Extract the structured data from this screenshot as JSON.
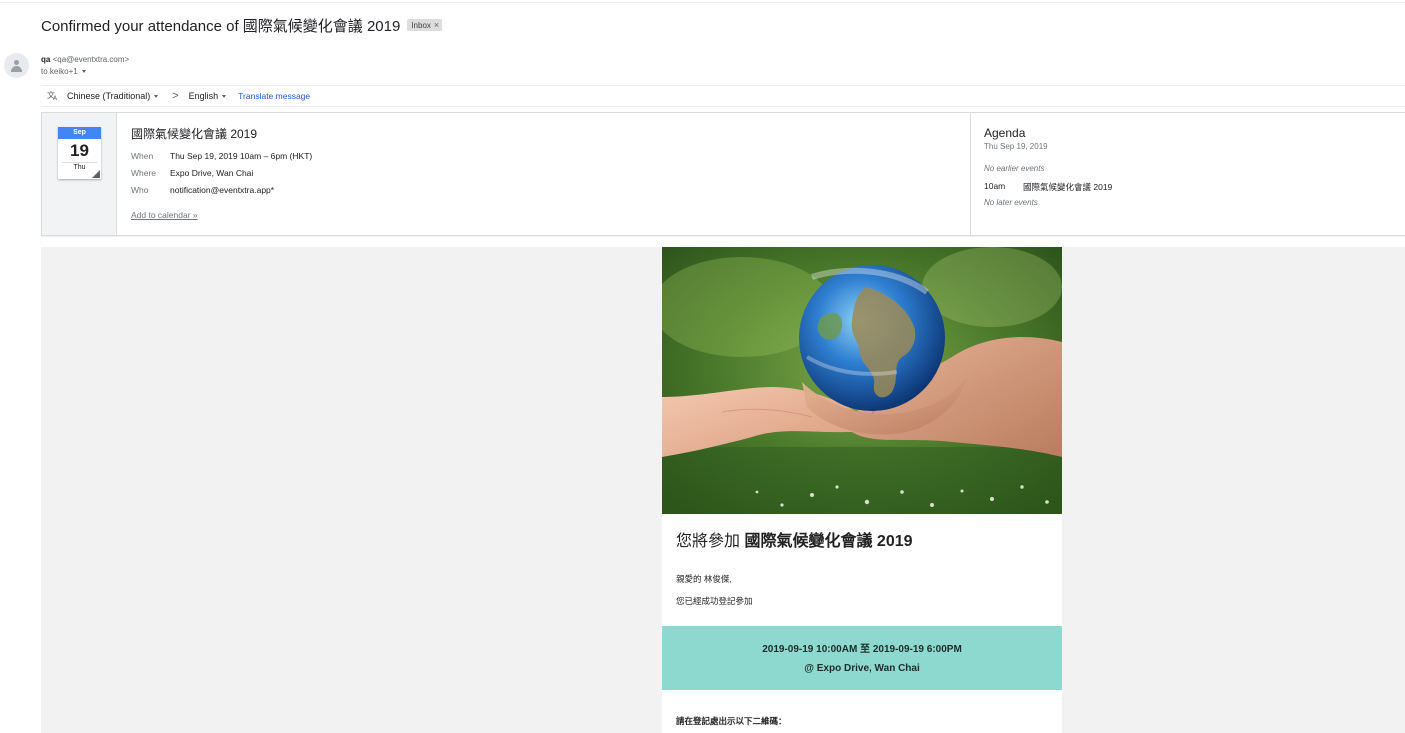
{
  "email": {
    "subject": "Confirmed your attendance of 國際氣候變化會議 2019",
    "label": "Inbox",
    "label_remove": "×",
    "sender_name": "qa",
    "sender_email": "<qa@eventxtra.com>",
    "to": "to keiko+1"
  },
  "translate": {
    "source_lang": "Chinese (Traditional)",
    "arrow": ">",
    "target_lang": "English",
    "link": "Translate message"
  },
  "invite": {
    "month": "Sep",
    "day": "19",
    "dow": "Thu",
    "title": "國際氣候變化會議 2019",
    "when_label": "When",
    "when_value": "Thu Sep 19, 2019 10am – 6pm (HKT)",
    "where_label": "Where",
    "where_value": "Expo Drive, Wan Chai",
    "who_label": "Who",
    "who_value": "notification@eventxtra.app*",
    "add_link": "Add to calendar »"
  },
  "agenda": {
    "title": "Agenda",
    "date": "Thu Sep 19, 2019",
    "no_earlier": "No earlier events",
    "event_time": "10am",
    "event_title": "國際氣候變化會議 2019",
    "no_later": "No later events"
  },
  "body": {
    "heading_prefix": "您將參加",
    "heading_event": "國際氣候變化會議 2019",
    "greeting": "親愛的 林俊傑,",
    "registered": "您已經成功登記參加",
    "datetime": "2019-09-19 10:00AM 至 2019-09-19 6:00PM",
    "venue": "@ Expo Drive, Wan Chai",
    "qr_note": "請在登記處出示以下二維碼："
  },
  "colors": {
    "link_blue": "#1a5ad7",
    "calendar_blue": "#4285f4",
    "teal_banner": "#8ed9cf",
    "page_gray": "#f2f2f2"
  },
  "icons": {
    "translate": "translate-icon",
    "avatar": "person-avatar-icon"
  }
}
